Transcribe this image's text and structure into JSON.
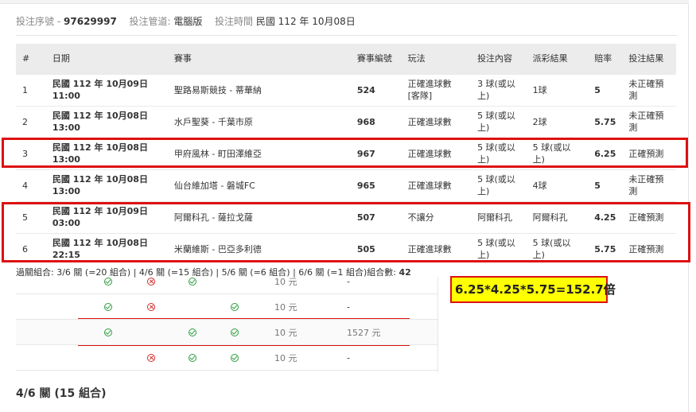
{
  "meta": {
    "serial_label": "投注序號",
    "serial_sep": "-",
    "serial_value": "97629997",
    "channel_label": "投注管道:",
    "channel_value": "電腦版",
    "time_label": "投注時間",
    "time_value": "民國 112 年 10月08日"
  },
  "table": {
    "headers": [
      "#",
      "日期",
      "賽事",
      "賽事編號",
      "玩法",
      "投注內容",
      "派彩結果",
      "賠率",
      "投注結果"
    ],
    "rows": [
      {
        "no": "1",
        "date": "民國 112 年 10月09日",
        "time": "11:00",
        "match": "聖路易斯競技 - 蒂華納",
        "code": "524",
        "play": "正確進球數",
        "play2": "[客隊]",
        "bet": "3 球(或以上)",
        "result": "1球",
        "odds": "5",
        "outcome": "未正確預測"
      },
      {
        "no": "2",
        "date": "民國 112 年 10月08日",
        "time": "13:00",
        "match": "水戶聖葵 - 千葉市原",
        "code": "968",
        "play": "正確進球數",
        "play2": "",
        "bet": "5 球(或以上)",
        "result": "2球",
        "odds": "5.75",
        "outcome": "未正確預測"
      },
      {
        "no": "3",
        "date": "民國 112 年 10月08日",
        "time": "13:00",
        "match": "甲府風林 - 町田澤維亞",
        "code": "967",
        "play": "正確進球數",
        "play2": "",
        "bet": "5 球(或以上)",
        "result": "5 球(或以上)",
        "odds": "6.25",
        "outcome": "正確預測"
      },
      {
        "no": "4",
        "date": "民國 112 年 10月08日",
        "time": "13:00",
        "match": "仙台維加塔 - 磐城FC",
        "code": "965",
        "play": "正確進球數",
        "play2": "",
        "bet": "5 球(或以上)",
        "result": "4球",
        "odds": "5",
        "outcome": "未正確預測"
      },
      {
        "no": "5",
        "date": "民國 112 年 10月09日",
        "time": "03:00",
        "match": "阿爾科孔 - 薩拉戈薩",
        "code": "507",
        "play": "不讓分",
        "play2": "",
        "bet": "阿爾科孔",
        "result": "阿爾科孔",
        "odds": "4.25",
        "outcome": "正確預測"
      },
      {
        "no": "6",
        "date": "民國 112 年 10月08日",
        "time": "22:15",
        "match": "米蘭維斯 - 巴亞多利德",
        "code": "505",
        "play": "正確進球數",
        "play2": "",
        "bet": "5 球(或以上)",
        "result": "5 球(或以上)",
        "odds": "5.75",
        "outcome": "正確預測"
      }
    ]
  },
  "combos": {
    "prefix": "過關組合: ",
    "text": "3/6 關 (=20 組合) | 4/6 關 (=15 組合) | 5/6 關 (=6 組合) | 6/6 關 (=1 組合)組合數:",
    "count": "42"
  },
  "sub_rows": [
    {
      "icons": [
        "ok",
        "no",
        "ok",
        ""
      ],
      "amount": "10 元",
      "payout": "-"
    },
    {
      "icons": [
        "ok",
        "no",
        "",
        "ok"
      ],
      "amount": "10 元",
      "payout": "-"
    },
    {
      "icons": [
        "ok",
        "",
        "ok",
        "ok"
      ],
      "amount": "10 元",
      "payout": "1527 元"
    },
    {
      "icons": [
        "",
        "no",
        "ok",
        "ok"
      ],
      "amount": "10 元",
      "payout": "-"
    }
  ],
  "calc_note": "6.25*4.25*5.75=152.7倍",
  "section": {
    "title_bold": "4/6 關",
    "title_rest": " (15 組合)"
  },
  "colors": {
    "highlight": "#dd1111",
    "note_bg": "#ffff00",
    "check": "#2e9e3e",
    "cross": "#d42b2b"
  }
}
